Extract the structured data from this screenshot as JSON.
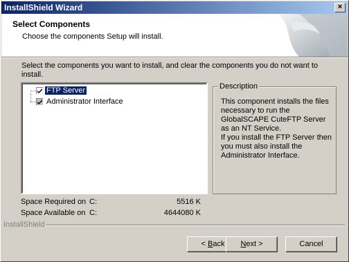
{
  "window": {
    "title": "InstallShield Wizard",
    "close_glyph": "×"
  },
  "header": {
    "title": "Select Components",
    "subtitle": "Choose the components Setup will install."
  },
  "instruction": "Select the components you want to install, and clear the components you do not want to install.",
  "components": [
    {
      "label": "FTP Server",
      "checked": true,
      "selected": true
    },
    {
      "label": "Administrator Interface",
      "checked": true,
      "grayed": true
    }
  ],
  "description": {
    "legend": "Description",
    "text": "This component installs the files necessary to run the GlobalSCAPE CuteFTP Server as an NT Service.\nIf you install the FTP Server then you must also install the Administrator Interface."
  },
  "space": {
    "required_label": "Space Required on",
    "required_drive": "C:",
    "required_value": "5516 K",
    "available_label": "Space Available on",
    "available_drive": "C:",
    "available_value": "4644080 K"
  },
  "brand": "InstallShield",
  "buttons": {
    "back": {
      "prefix": "< ",
      "mnemonic": "B",
      "rest": "ack"
    },
    "next": {
      "mnemonic": "N",
      "rest": "ext >"
    },
    "cancel": "Cancel"
  }
}
